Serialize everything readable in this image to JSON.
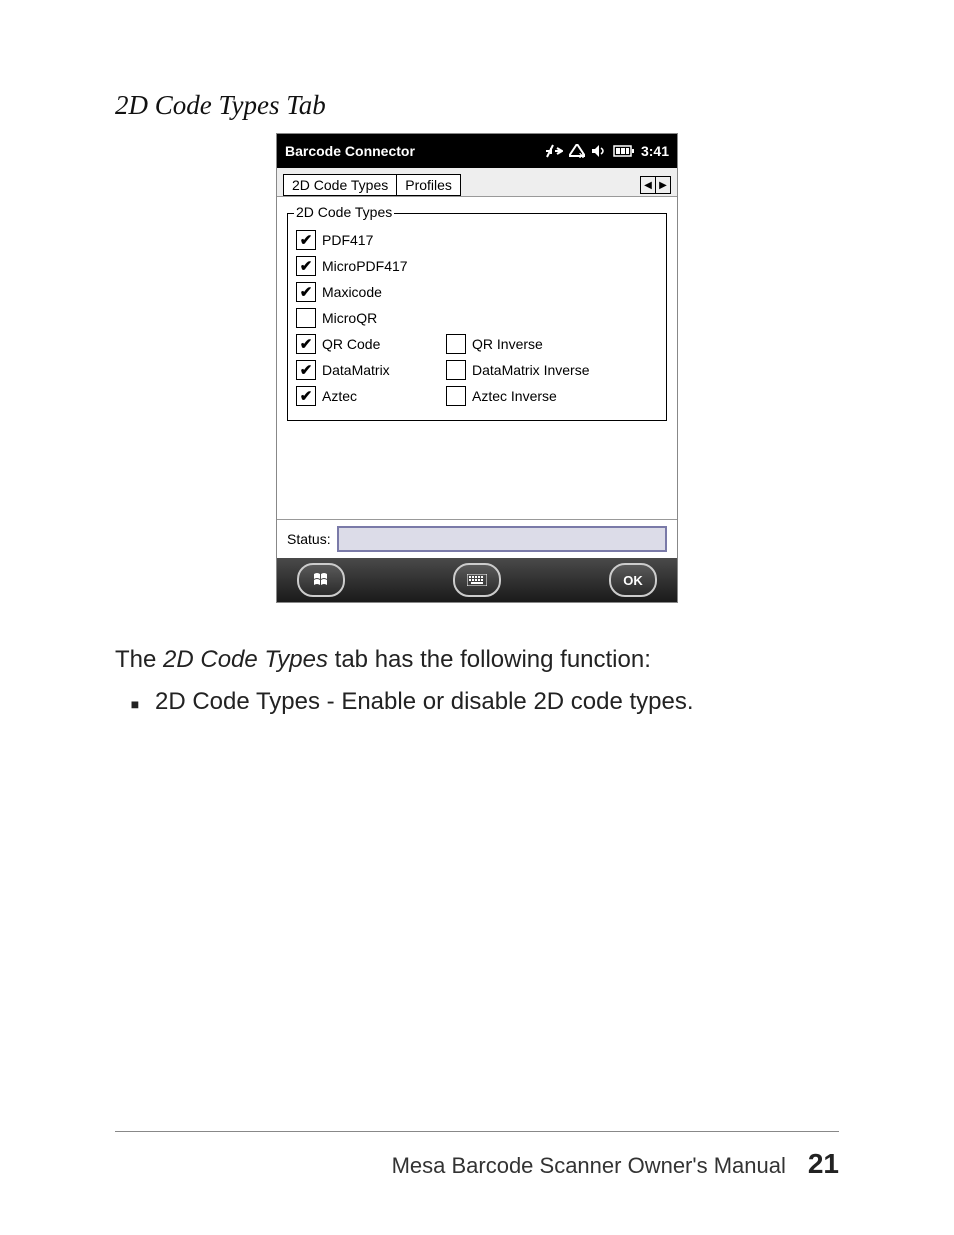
{
  "section_title": "2D Code Types Tab",
  "screenshot": {
    "titlebar": {
      "title": "Barcode Connector",
      "time": "3:41"
    },
    "tabs": {
      "active": "2D Code Types",
      "other": "Profiles"
    },
    "group_label": "2D Code Types",
    "checkboxes_left": [
      {
        "label": "PDF417",
        "checked": true
      },
      {
        "label": "MicroPDF417",
        "checked": true
      },
      {
        "label": "Maxicode",
        "checked": true
      },
      {
        "label": "MicroQR",
        "checked": false
      },
      {
        "label": "QR Code",
        "checked": true
      },
      {
        "label": "DataMatrix",
        "checked": true
      },
      {
        "label": "Aztec",
        "checked": true
      }
    ],
    "checkboxes_right": {
      "4": {
        "label": "QR Inverse",
        "checked": false
      },
      "5": {
        "label": "DataMatrix Inverse",
        "checked": false
      },
      "6": {
        "label": "Aztec Inverse",
        "checked": false
      }
    },
    "status_label": "Status:",
    "ok_label": "OK"
  },
  "description": {
    "intro_prefix": "The ",
    "intro_italic": "2D Code Types",
    "intro_suffix": " tab has the following function:",
    "bullet": "2D Code Types - Enable or disable 2D code types."
  },
  "footer": {
    "manual": "Mesa Barcode Scanner Owner's Manual",
    "page": "21"
  }
}
